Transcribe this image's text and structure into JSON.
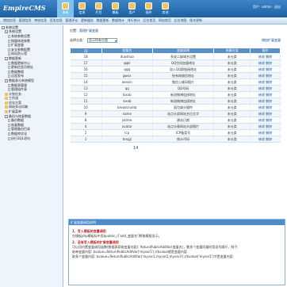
{
  "header": {
    "logo_text": "EmpireCMS",
    "nav": [
      {
        "label": "系统",
        "active": true
      },
      {
        "label": "信息"
      },
      {
        "label": "栏目"
      },
      {
        "label": "模板"
      },
      {
        "label": "用户"
      },
      {
        "label": "插件"
      },
      {
        "label": "其他"
      }
    ],
    "user_label": "用户",
    "user_name": "admin",
    "logout": "退出"
  },
  "subnav": [
    "增加信息",
    "管理信息",
    "审核信息",
    "签发信息",
    "管理评论",
    "更新缓存",
    "数据更新",
    "数据统计",
    "排行统计",
    "后台首页",
    "网站首页",
    "后台地图",
    "版本更新"
  ],
  "sidebar": [
    {
      "indent": 0,
      "type": "box",
      "label": "系统设置"
    },
    {
      "indent": 1,
      "type": "box",
      "label": "系统设置"
    },
    {
      "indent": 2,
      "type": "leaf",
      "label": "系统参数设置"
    },
    {
      "indent": 2,
      "type": "leaf",
      "label": "指量修改参数"
    },
    {
      "indent": 2,
      "type": "leaf",
      "label": "扩展变量"
    },
    {
      "indent": 2,
      "type": "leaf",
      "label": "安全参数配置"
    },
    {
      "indent": 2,
      "type": "leaf",
      "label": "网站防火墙"
    },
    {
      "indent": 1,
      "type": "box",
      "label": "数据更新"
    },
    {
      "indent": 2,
      "type": "leaf",
      "label": "数据更新中心"
    },
    {
      "indent": 2,
      "type": "leaf",
      "label": "更新信息页地址"
    },
    {
      "indent": 2,
      "type": "leaf",
      "label": "数据整理"
    },
    {
      "indent": 2,
      "type": "leaf",
      "label": "远程发布"
    },
    {
      "indent": 1,
      "type": "box",
      "label": "数据表与系统模型"
    },
    {
      "indent": 2,
      "type": "leaf",
      "label": "数据表管理"
    },
    {
      "indent": 2,
      "type": "leaf",
      "label": "管理插件表"
    },
    {
      "indent": 1,
      "type": "fold",
      "label": "计划任务"
    },
    {
      "indent": 1,
      "type": "fold",
      "label": "工作流"
    },
    {
      "indent": 1,
      "type": "fold",
      "label": "优化方案"
    },
    {
      "indent": 1,
      "type": "fold",
      "label": "网站多访问端"
    },
    {
      "indent": 1,
      "type": "fold",
      "label": "扩展菜单"
    },
    {
      "indent": 1,
      "type": "box",
      "label": "备份与恢复数据"
    },
    {
      "indent": 2,
      "type": "leaf",
      "label": "备份数据"
    },
    {
      "indent": 2,
      "type": "leaf",
      "label": "恢复数据"
    },
    {
      "indent": 2,
      "type": "leaf",
      "label": "管理备份目录"
    },
    {
      "indent": 2,
      "type": "leaf",
      "label": "数据库优化"
    },
    {
      "indent": 2,
      "type": "leaf",
      "label": "执行SQL语句"
    }
  ],
  "main": {
    "crumb_prefix": "位置：",
    "crumb_link": "管理扩展变量",
    "select_label": "选择分类：",
    "select_value": "显示所有分类",
    "add_link": "增加扩展变量",
    "columns": [
      "ID",
      "变量名",
      "变量说明",
      "所属分类",
      "操作"
    ],
    "rows": [
      {
        "id": "18",
        "name": "duoshuo",
        "desc": "多说二级域名设置",
        "cat": "未分类",
        "op": "修改 删除"
      },
      {
        "id": "17",
        "name": "qqkl",
        "desc": "QQ空间加量地址",
        "cat": "未分类",
        "op": "修改 删除"
      },
      {
        "id": "16",
        "name": "qqq",
        "desc": "加入QQ群链接地址",
        "cat": "未分类",
        "op": "修改 删除"
      },
      {
        "id": "15",
        "name": "gwxx",
        "desc": "绘有网络信地址",
        "cat": "未分类",
        "op": "修改 删除"
      },
      {
        "id": "14",
        "name": "weixin",
        "desc": "微信二维码图片",
        "cat": "未分类",
        "op": "修改 删除"
      },
      {
        "id": "13",
        "name": "qq",
        "desc": "QQ号码",
        "cat": "未分类",
        "op": "修改 删除"
      },
      {
        "id": "12",
        "name": "tsxxb",
        "desc": "新浪微博连接地址",
        "cat": "未分类",
        "op": "修改 删除"
      },
      {
        "id": "11",
        "name": "sixxb",
        "desc": "新浪微博连接地址",
        "cat": "未分类",
        "op": "修改 删除"
      },
      {
        "id": "10",
        "name": "breadcrumb",
        "desc": "面包屑分隔符",
        "cat": "未分类",
        "op": "修改 删除"
      },
      {
        "id": "9",
        "name": "name",
        "desc": "站点头部网站名位文字",
        "cat": "未分类",
        "op": "修改 删除"
      },
      {
        "id": "8",
        "name": "jstime",
        "desc": "建站日期",
        "cat": "未分类",
        "op": "修改 删除"
      },
      {
        "id": "4",
        "name": "avatar",
        "desc": "站点头像网站头部图片",
        "cat": "未分类",
        "op": "修改 删除"
      },
      {
        "id": "2",
        "name": "icp",
        "desc": "ICP备案号",
        "cat": "未分类",
        "op": "修改 删除"
      },
      {
        "id": "1",
        "name": "tongji",
        "desc": "统计代码",
        "cat": "未分类",
        "op": "修改 删除"
      }
    ],
    "pager": "14"
  },
  "help": {
    "title": "扩展变量调用说明",
    "h1": "1、写入模板的变量调用",
    "p1": "在模板php模板标中用$public_r['add_变量名']将能模版显示。",
    "h2": "2、没有写入模板的扩展变量调用",
    "p2": "可以用内置变量调用函数(数据表获取变量内容): ReturnPublicAddVar(变量名)，数多个变量同量时用逗号隔开，例子:",
    "p3": "取单变量内容: $value=ReturnPublicAddVar('myvar1');//$value就是变量内容",
    "p4": "取多个变量内容: $value=ReturnPublicAddVar('myvar1,myvar2,myvar3');//$value['myvar1']才是变量内容"
  }
}
